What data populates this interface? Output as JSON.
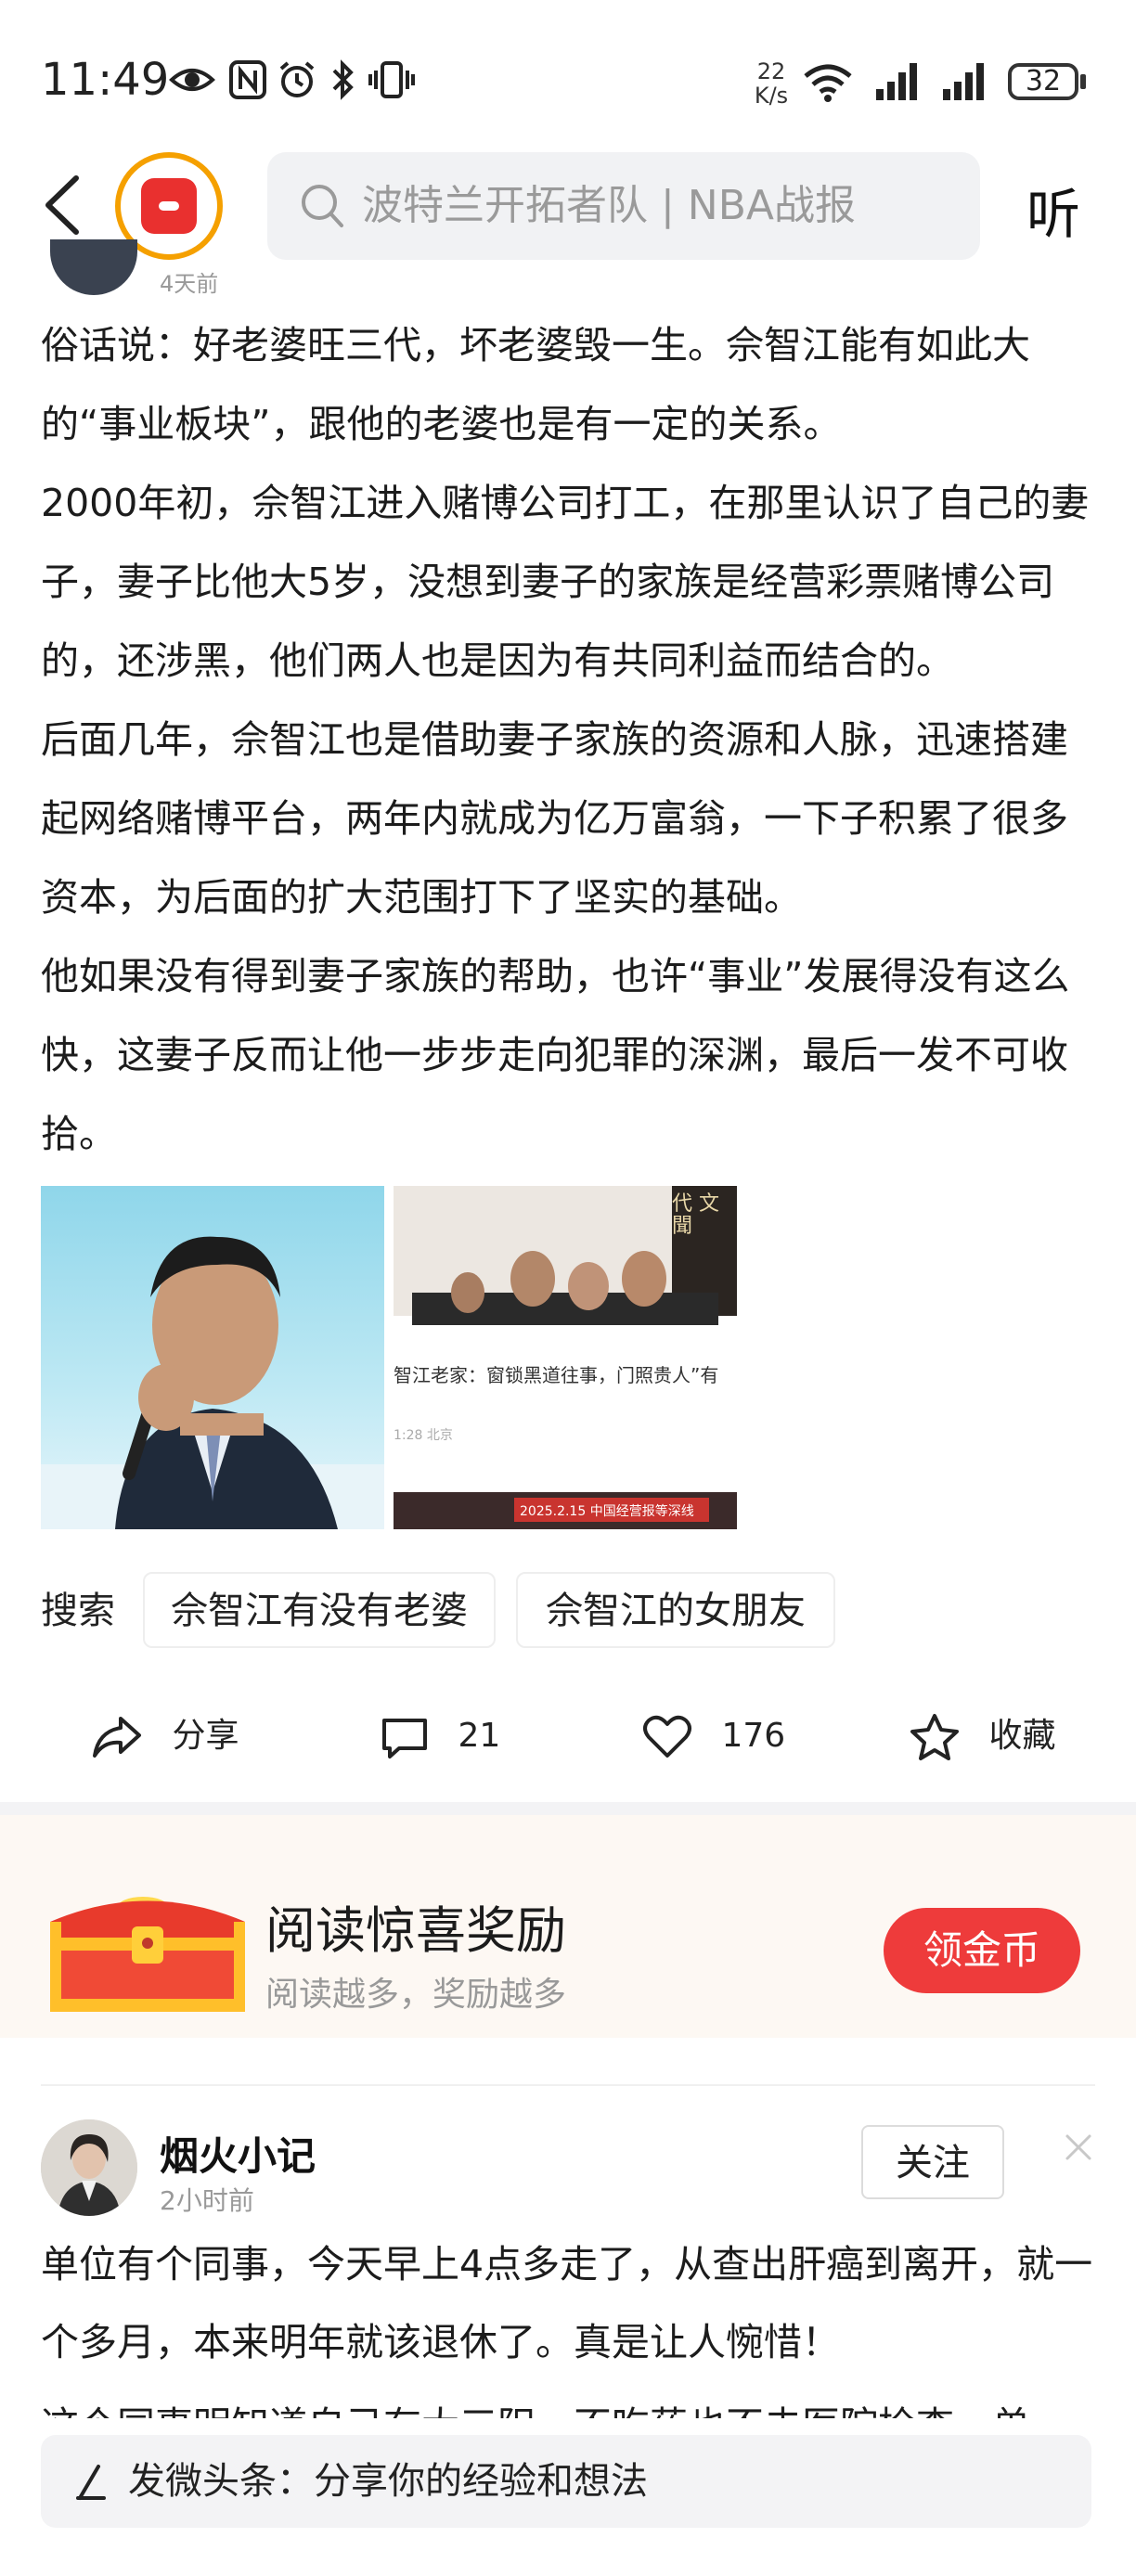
{
  "status_bar": {
    "time": "11:49",
    "net_speed_value": "22",
    "net_speed_unit": "K/s",
    "battery": "32"
  },
  "nav": {
    "search_placeholder": "波特兰开拓者队 | NBA战报",
    "listen_label": "听"
  },
  "article": {
    "peek_time": "4天前",
    "paragraphs": [
      "俗话说：好老婆旺三代，坏老婆毁一生。佘智江能有如此大的“事业板块”，跟他的老婆也是有一定的关系。",
      "2000年初，佘智江进入赌博公司打工，在那里认识了自己的妻子，妻子比他大5岁，没想到妻子的家族是经营彩票赌博公司的，还涉黑，他们两人也是因为有共同利益而结合的。",
      "后面几年，佘智江也是借助妻子家族的资源和人脉，迅速搭建起网络赌博平台，两年内就成为亿万富翁，一下子积累了很多资本，为后面的扩大范围打下了坚实的基础。",
      "他如果没有得到妻子家族的帮助，也许“事业”发展得没有这么快，这妻子反而让他一步步走向犯罪的深渊，最后一发不可收拾。"
    ],
    "image2_caption": "智江老家：窗锁黑道往事，门照贵人”有",
    "image2_meta": "1:28  北京",
    "image2_banner": "2025.2.15 中国经营报等深线",
    "image2_sign": "代 文 聞"
  },
  "related_search": {
    "label": "搜索",
    "tags": [
      "佘智江有没有老婆",
      "佘智江的女朋友"
    ]
  },
  "actions": {
    "share": "分享",
    "comments": "21",
    "likes": "176",
    "favorite": "收藏"
  },
  "reward": {
    "title": "阅读惊喜奖励",
    "subtitle": "阅读越多，奖励越多",
    "button": "领金币"
  },
  "post2": {
    "author": "烟火小记",
    "time": "2小时前",
    "follow": "关注",
    "text": "单位有个同事，今天早上4点多走了，从查出肝癌到离开，就一个多月，本来明年就该退休了。真是让人惋惜！",
    "text_cut": "这个同事明知道自己有大三阳，不吃药也不去医院检查，单"
  },
  "composer": {
    "placeholder": "发微头条：分享你的经验和想法"
  }
}
